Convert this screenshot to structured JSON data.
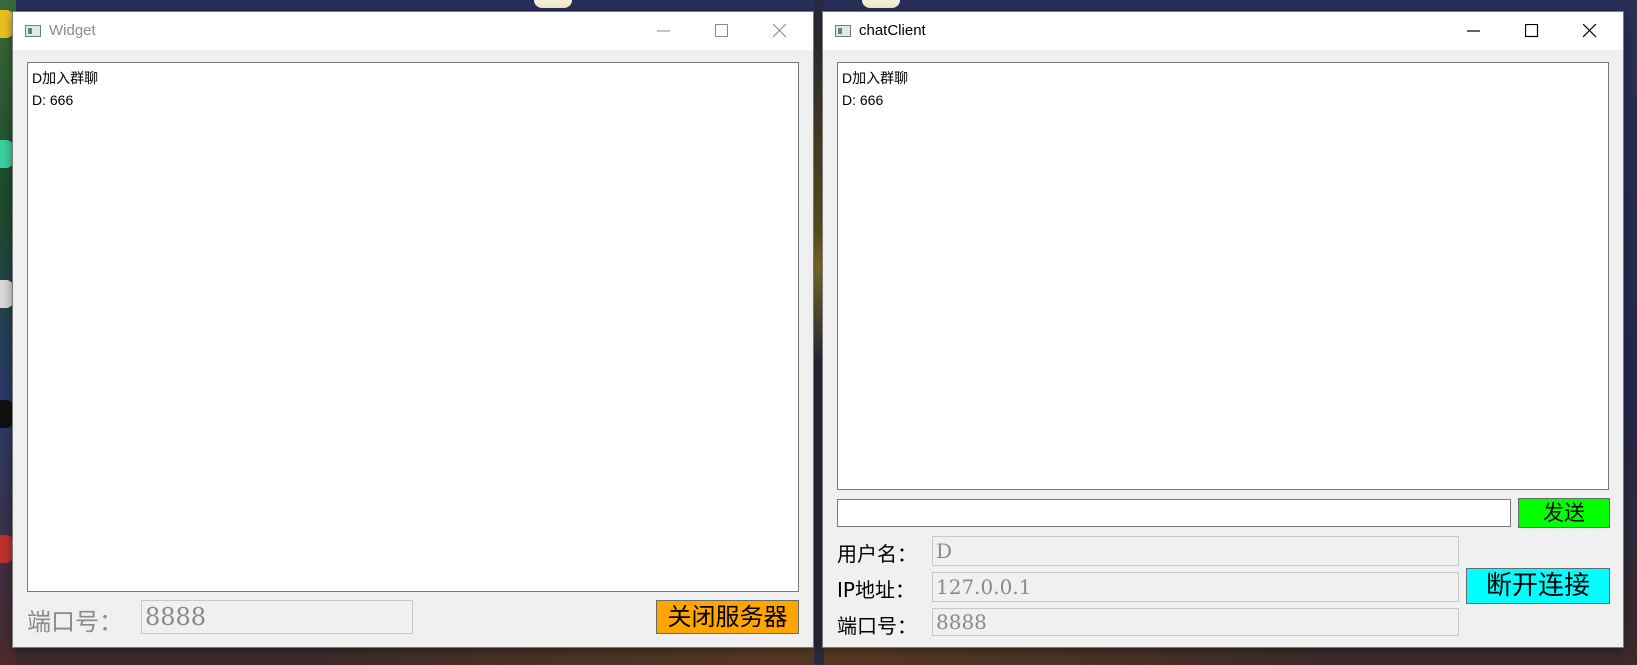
{
  "server_window": {
    "title": "Widget",
    "chat_log": [
      "D加入群聊",
      "D: 666"
    ],
    "port_label": "端口号：",
    "port_value": "8888",
    "close_server_label": "关闭服务器",
    "close_server_color": "#ffa500"
  },
  "client_window": {
    "title": "chatClient",
    "chat_log": [
      "D加入群聊",
      "D: 666"
    ],
    "message_value": "",
    "send_label": "发送",
    "send_color": "#00ff00",
    "username_label": "用户名：",
    "username_value": "D",
    "ip_label": "IP地址：",
    "ip_value": "127.0.0.1",
    "port_label": "端口号：",
    "port_value": "8888",
    "disconnect_label": "断开连接",
    "disconnect_color": "#00ffff"
  },
  "icons": {
    "window_app": "app-window-icon",
    "minimize": "minimize-icon",
    "maximize": "maximize-icon",
    "close": "close-icon"
  }
}
